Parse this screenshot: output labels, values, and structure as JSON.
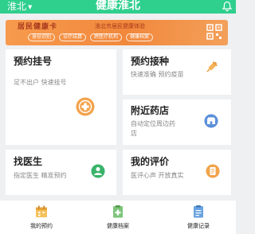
{
  "header": {
    "city": "淮北",
    "title": "健康淮北"
  },
  "banner": {
    "title": "居民健康卡",
    "subtitle": "淮北市居民健康体验",
    "tags": [
      "身份识别",
      "诊疗结算",
      "跨医疗机构",
      "健康档案"
    ]
  },
  "cards": {
    "appointment": {
      "title": "预约挂号",
      "subtitle": "足不出户 快速挂号"
    },
    "vaccination": {
      "title": "预约接种",
      "subtitle": "快速准确 预约疫苗"
    },
    "pharmacy": {
      "title": "附近药店",
      "subtitle_line1": "自动定位周边药",
      "subtitle_line2": "店"
    },
    "find_doctor": {
      "title": "找医生",
      "subtitle": "指定医生 精准预约"
    },
    "my_review": {
      "title": "我的评价",
      "subtitle": "医评心声 开放真实"
    }
  },
  "bottom_nav": [
    {
      "label": "我的预约",
      "icon": "calendar-icon"
    },
    {
      "label": "健康档案",
      "icon": "health-file-icon"
    },
    {
      "label": "健康记录",
      "icon": "health-record-icon"
    }
  ],
  "colors": {
    "primary": "#2fcf8e",
    "banner": "#f1883c",
    "accent_orange": "#f2a34b",
    "green_icon": "#3ab36b",
    "blue_icon": "#5b8fd8"
  }
}
